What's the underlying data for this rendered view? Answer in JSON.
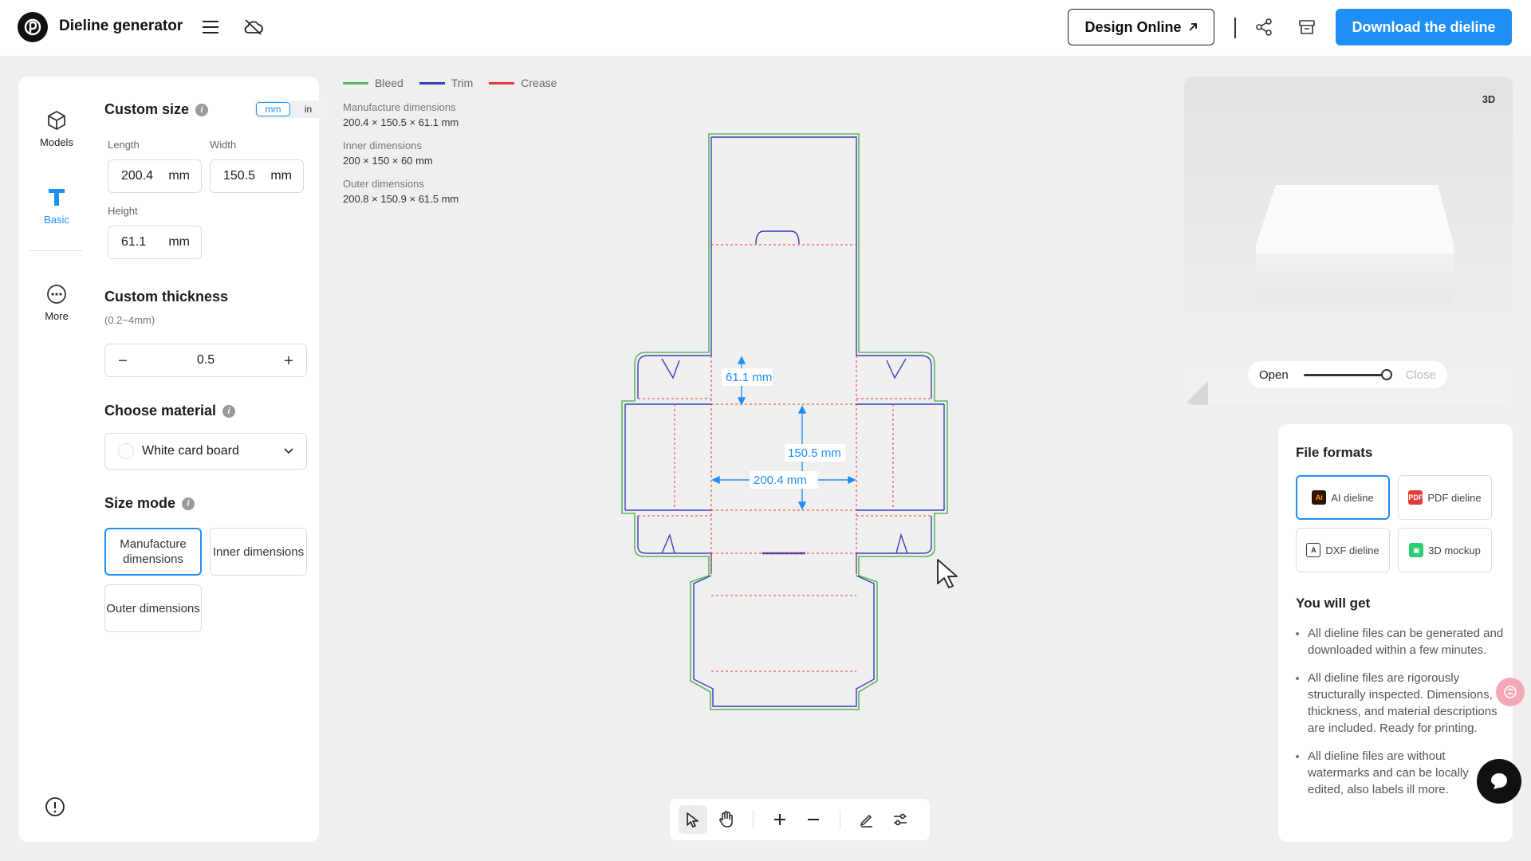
{
  "header": {
    "title": "Dieline generator",
    "design_online": "Design Online",
    "download": "Download the dieline"
  },
  "rail": {
    "models": "Models",
    "basic": "Basic",
    "more": "More"
  },
  "custom_size": {
    "title": "Custom size",
    "units": [
      "mm",
      "in"
    ],
    "selected_unit": "mm",
    "length_label": "Length",
    "length_value": "200.4",
    "width_label": "Width",
    "width_value": "150.5",
    "height_label": "Height",
    "height_value": "61.1",
    "unit": "mm"
  },
  "thickness": {
    "title": "Custom thickness",
    "range": "(0.2~4mm)",
    "value": "0.5"
  },
  "material": {
    "title": "Choose material",
    "selected": "White card board"
  },
  "size_mode": {
    "title": "Size mode",
    "options": [
      "Manufacture dimensions",
      "Inner dimensions",
      "Outer dimensions"
    ],
    "selected": "Manufacture dimensions"
  },
  "legend": [
    {
      "label": "Bleed",
      "color": "#5cb85c"
    },
    {
      "label": "Trim",
      "color": "#3b3fb8"
    },
    {
      "label": "Crease",
      "color": "#e53935"
    }
  ],
  "dimensions": {
    "manufacture_label": "Manufacture dimensions",
    "manufacture_value": "200.4 × 150.5 × 61.1 mm",
    "inner_label": "Inner dimensions",
    "inner_value": "200 × 150 × 60 mm",
    "outer_label": "Outer dimensions",
    "outer_value": "200.8 × 150.9 × 61.5 mm"
  },
  "dieline_labels": {
    "height": "61.1 mm",
    "width": "150.5 mm",
    "length": "200.4 mm"
  },
  "preview": {
    "badge": "3D",
    "open": "Open",
    "close": "Close",
    "level": 1.0
  },
  "file_formats": {
    "title": "File formats",
    "items": [
      {
        "label": "AI dieline",
        "icon": "ai-file-icon",
        "color": "#ff7c00"
      },
      {
        "label": "PDF dieline",
        "icon": "pdf-file-icon",
        "color": "#e53935"
      },
      {
        "label": "DXF dieline",
        "icon": "dxf-file-icon",
        "color": "#333333"
      },
      {
        "label": "3D mockup",
        "icon": "mockup-icon",
        "color": "#2ecc71"
      }
    ],
    "selected": "AI dieline"
  },
  "you_will_get": {
    "title": "You will get",
    "items": [
      "All dieline files can be generated and downloaded within a few minutes.",
      "All dieline files are rigorously structurally inspected. Dimensions, thickness, and material descriptions are included. Ready for printing.",
      "All dieline files are without watermarks and can be locally edited, also labels ill more."
    ]
  },
  "colors": {
    "accent": "#1f8ff6",
    "bleed": "#5cb85c",
    "trim": "#3b3fb8",
    "crease": "#e53935"
  }
}
